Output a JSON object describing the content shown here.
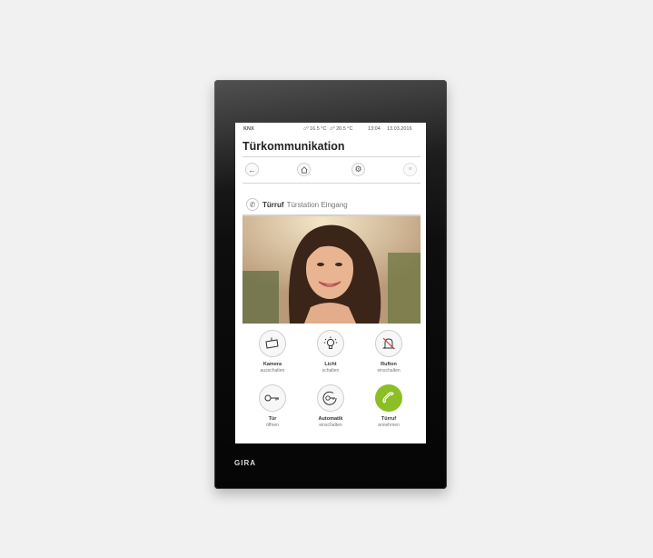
{
  "device": {
    "brand": "GIRA"
  },
  "status": {
    "knx": "KNX",
    "temp_inside": "16.5 °C",
    "temp_outside": "20.5 °C",
    "time": "13:04",
    "date": "13.03.2016"
  },
  "title": "Türkommunikation",
  "nav": {
    "icons": [
      "back-arrow-icon",
      "home-icon",
      "settings-icon",
      "list-icon"
    ]
  },
  "call": {
    "label": "Türruf",
    "station": "Türstation Eingang"
  },
  "actions": [
    {
      "line1": "Kamera",
      "line2": "ausschalten",
      "icon": "camera-icon"
    },
    {
      "line1": "Licht",
      "line2": "schalten",
      "icon": "light-bulb-icon"
    },
    {
      "line1": "Rufton",
      "line2": "einschalten",
      "icon": "bell-muted-icon"
    },
    {
      "line1": "Tür",
      "line2": "öffnen",
      "icon": "key-icon"
    },
    {
      "line1": "Automatik",
      "line2": "einschalten",
      "icon": "auto-key-icon"
    },
    {
      "line1": "Türruf",
      "line2": "annehmen",
      "icon": "phone-icon"
    }
  ],
  "colors": {
    "accept": "#8cbf26",
    "device": "#0e0e0e"
  }
}
